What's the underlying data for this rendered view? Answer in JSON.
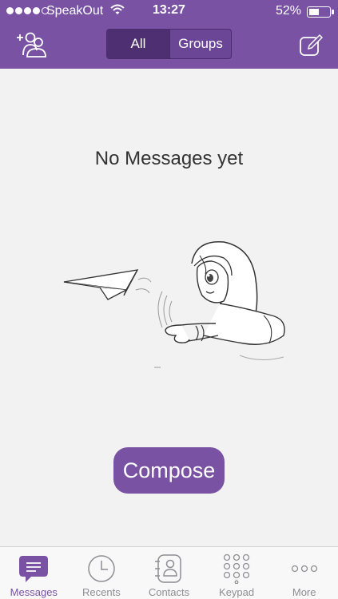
{
  "status_bar": {
    "carrier": "SpeakOut",
    "time": "13:27",
    "battery_percent": "52%",
    "battery_level": 0.52,
    "signal_bars_filled": 4,
    "signal_bars_total": 5
  },
  "header": {
    "segments": [
      {
        "label": "All",
        "selected": true
      },
      {
        "label": "Groups",
        "selected": false
      }
    ],
    "left_icon": "add-contact-icon",
    "right_icon": "compose-edit-icon"
  },
  "main": {
    "empty_title": "No Messages yet",
    "compose_label": "Compose",
    "illustration": "girl-with-paper-plane"
  },
  "tabbar": {
    "items": [
      {
        "label": "Messages",
        "icon": "messages-icon",
        "active": true
      },
      {
        "label": "Recents",
        "icon": "clock-icon",
        "active": false
      },
      {
        "label": "Contacts",
        "icon": "contacts-icon",
        "active": false
      },
      {
        "label": "Keypad",
        "icon": "keypad-icon",
        "active": false
      },
      {
        "label": "More",
        "icon": "more-icon",
        "active": false
      }
    ]
  },
  "colors": {
    "brand": "#7a52a4",
    "segment_selected": "#4d2f72",
    "background": "#f2f2f3",
    "tab_inactive": "#8e8e93"
  }
}
